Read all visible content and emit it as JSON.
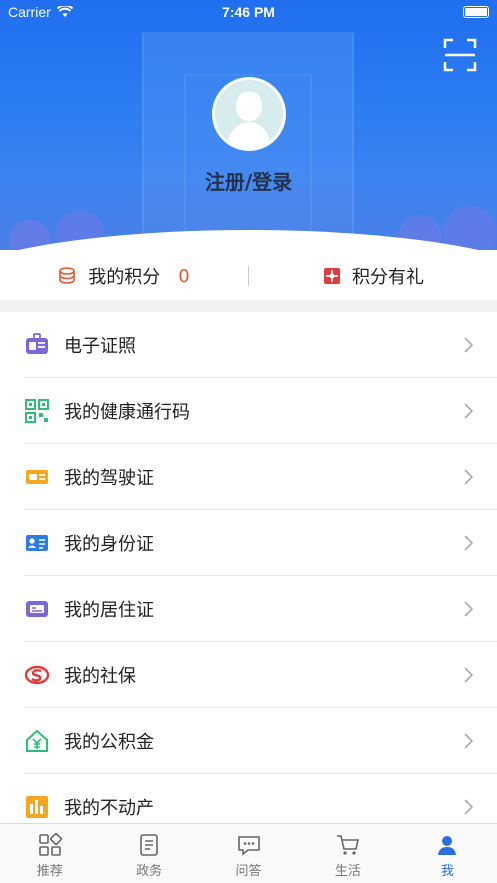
{
  "status_bar": {
    "carrier": "Carrier",
    "time": "7:46 PM"
  },
  "header": {
    "login_label": "注册/登录"
  },
  "points": {
    "my_points_label": "我的积分",
    "my_points_value": "0",
    "rewards_label": "积分有礼"
  },
  "list": [
    {
      "label": "电子证照",
      "icon": "id-badge-icon"
    },
    {
      "label": "我的健康通行码",
      "icon": "qr-code-icon"
    },
    {
      "label": "我的驾驶证",
      "icon": "driver-license-icon"
    },
    {
      "label": "我的身份证",
      "icon": "id-card-icon"
    },
    {
      "label": "我的居住证",
      "icon": "residence-permit-icon"
    },
    {
      "label": "我的社保",
      "icon": "social-security-icon"
    },
    {
      "label": "我的公积金",
      "icon": "housing-fund-icon"
    },
    {
      "label": "我的不动产",
      "icon": "real-estate-icon"
    }
  ],
  "tabs": [
    {
      "label": "推荐",
      "icon": "grid-icon"
    },
    {
      "label": "政务",
      "icon": "document-list-icon"
    },
    {
      "label": "问答",
      "icon": "chat-bubble-icon"
    },
    {
      "label": "生活",
      "icon": "shopping-cart-icon"
    },
    {
      "label": "我",
      "icon": "user-icon"
    }
  ],
  "colors": {
    "accent": "#2a6fe0",
    "points_value": "#e4572e"
  }
}
